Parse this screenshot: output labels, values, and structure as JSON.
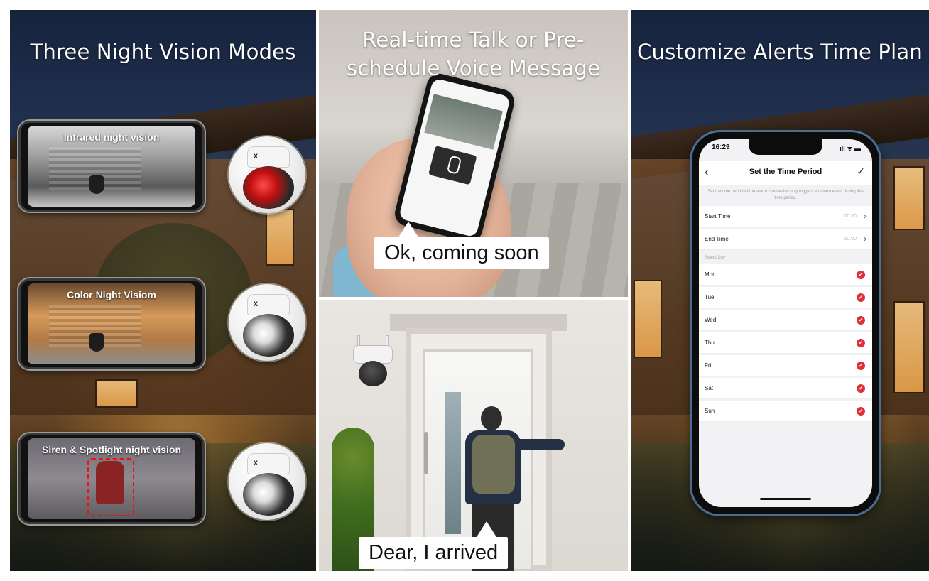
{
  "left_panel": {
    "title": "Three Night Vision Modes",
    "modes": [
      {
        "label": "Infrared night vision",
        "light": "infrared red"
      },
      {
        "label": "Color Night Visiom",
        "light": "white spotlight"
      },
      {
        "label": "Siren & Spotlight night vision",
        "light": "white spotlight"
      }
    ],
    "camera_brand": "X"
  },
  "middle_top_panel": {
    "title_line1": "Real-time Talk or Pre-",
    "title_line2": "schedule Voice Message",
    "speech": "Ok, coming soon"
  },
  "middle_bottom_panel": {
    "speech": "Dear, I arrived"
  },
  "right_panel": {
    "title": "Customize Alerts Time Plan",
    "phone": {
      "status_time": "16:29",
      "status_icons": "ıll ᯤ ▬",
      "nav_title": "Set the Time Period",
      "back_icon": "‹",
      "confirm_icon": "✓",
      "hint": "Set the time period of the alarm, the device only triggers an alarm event during this time period.",
      "start_time_label": "Start Time",
      "start_time_value": "00:00",
      "end_time_label": "End Time",
      "end_time_value": "00:00",
      "select_day_label": "Select Day",
      "days": [
        {
          "name": "Mon",
          "checked": true
        },
        {
          "name": "Tue",
          "checked": true
        },
        {
          "name": "Wed",
          "checked": true
        },
        {
          "name": "Thu",
          "checked": true
        },
        {
          "name": "Fri",
          "checked": true
        },
        {
          "name": "Sat",
          "checked": true
        },
        {
          "name": "Sun",
          "checked": true
        }
      ],
      "check_color": "#e0313a"
    }
  }
}
